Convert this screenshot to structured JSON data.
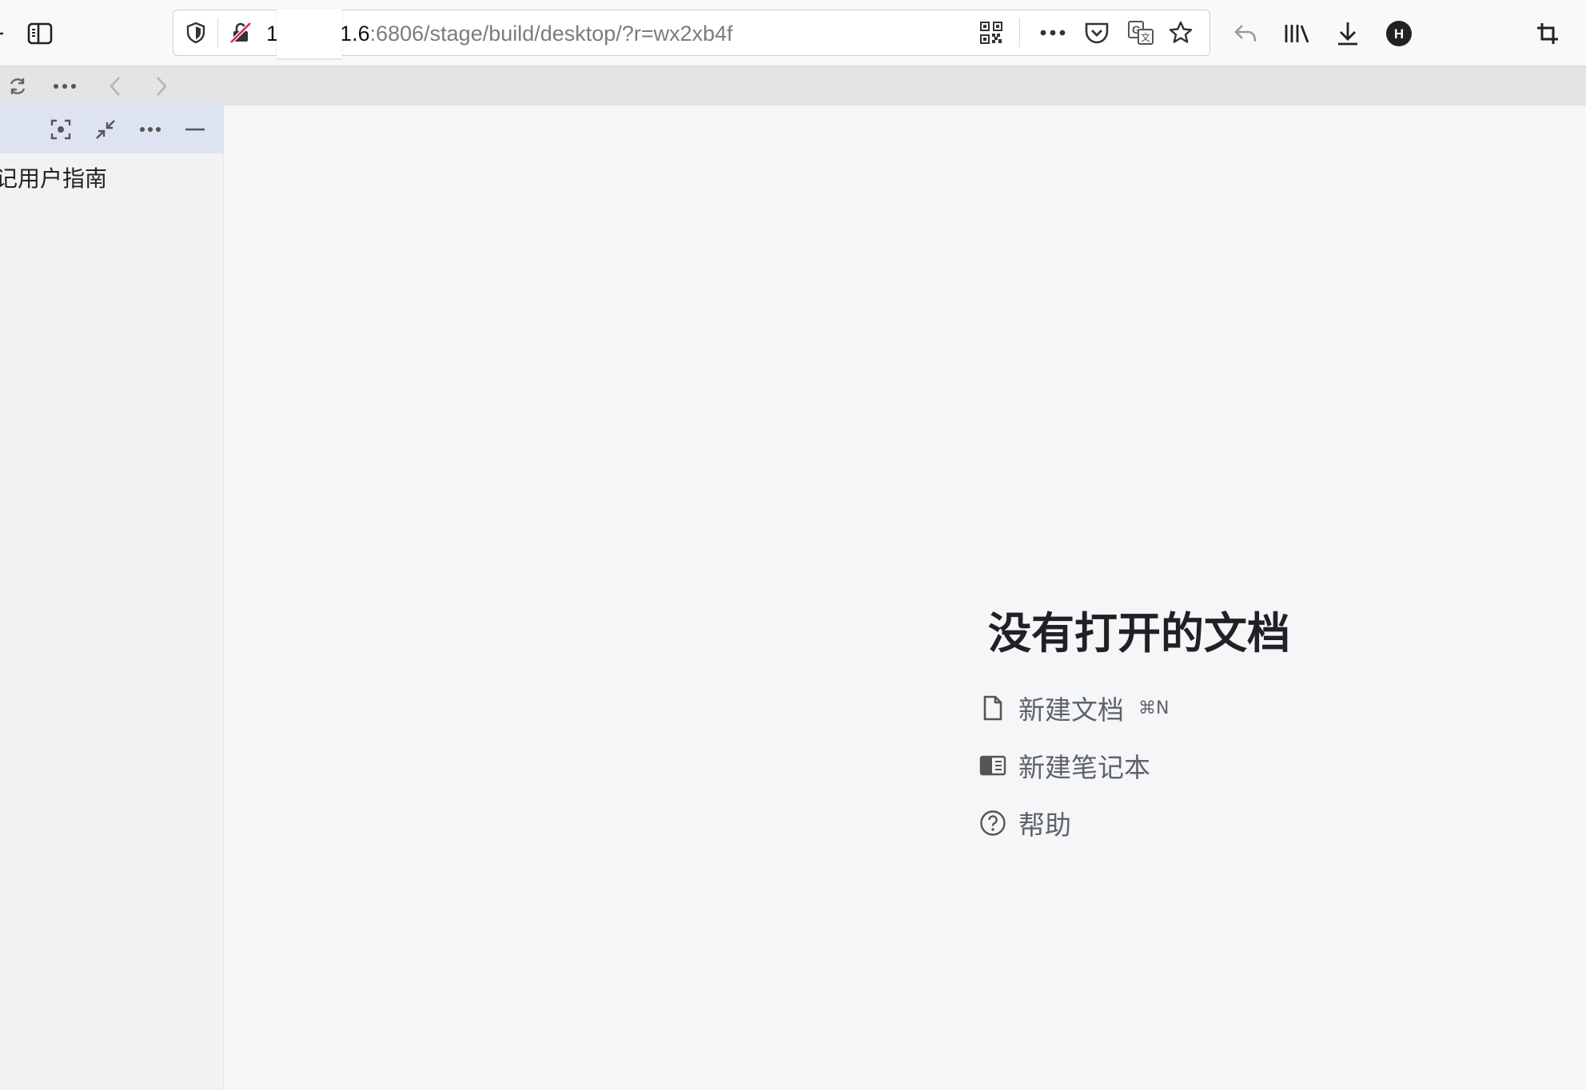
{
  "browser": {
    "url_host": "1",
    "url_host_tail": ".1.6",
    "url_rest": ":6806/stage/build/desktop/?r=wx2xb4f",
    "icons": {
      "left_edge": "back-arrow-icon",
      "sidebar_toggle": "sidebar-toggle-icon",
      "tracking": "shield-icon",
      "insecure": "lock-insecure-icon",
      "qr": "qr-code-icon",
      "page_actions": "more-horizontal-icon",
      "pocket": "pocket-icon",
      "translate": "translate-icon",
      "bookmark": "star-icon",
      "undo": "undo-arrow-icon",
      "library": "library-icon",
      "downloads": "download-icon",
      "profile": "profile-avatar-icon",
      "profile_letter": "H",
      "screenshot": "crop-icon"
    }
  },
  "app_tabbar": {
    "icons": [
      "sync-icon",
      "more-icon",
      "chevron-left-icon",
      "chevron-right-icon"
    ]
  },
  "sidebar": {
    "header_icons": [
      "focus-icon",
      "collapse-all-icon",
      "more-icon",
      "minimize-icon"
    ],
    "items": [
      {
        "label": "思源笔记用户指南",
        "visible_text": "记用户指南"
      }
    ]
  },
  "empty_state": {
    "title": "没有打开的文档",
    "actions": [
      {
        "icon": "file-icon",
        "label": "新建文档",
        "shortcut": "⌘N"
      },
      {
        "icon": "notebook-icon",
        "label": "新建笔记本",
        "shortcut": ""
      },
      {
        "icon": "help-circle-icon",
        "label": "帮助",
        "shortcut": ""
      }
    ]
  },
  "colors": {
    "sidebar_header_bg": "#dde3f1",
    "editor_bg": "#f5f6f8",
    "tabbar_bg": "#e3e4e6",
    "insecure_red": "#e22850"
  }
}
